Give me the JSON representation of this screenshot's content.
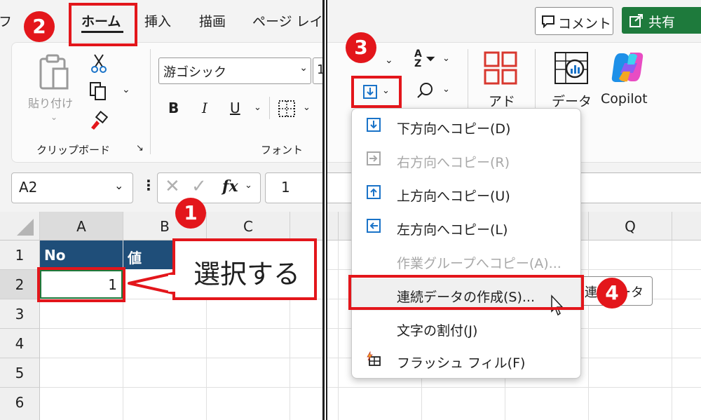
{
  "left_panel": {
    "tabs": {
      "file_partial": "フ",
      "home": "ホーム",
      "insert": "挿入",
      "draw": "描画",
      "page_partial": "ページ レイ"
    },
    "clipboard": {
      "paste_label": "貼り付け",
      "group_label": "クリップボード"
    },
    "font": {
      "font_name": "游ゴシック",
      "size_partial": "1",
      "bold": "B",
      "italic": "I",
      "underline": "U",
      "group_label": "フォント"
    },
    "formula_bar": {
      "name_box": "A2",
      "fx": "fx",
      "value": "1"
    },
    "columns": [
      "A",
      "B",
      "C"
    ],
    "rows": [
      "1",
      "2",
      "3",
      "4",
      "5",
      "6"
    ],
    "cells": {
      "a1": "No",
      "b1": "値",
      "a2": "1"
    },
    "callout": "選択する"
  },
  "right_panel": {
    "header": {
      "comment_button": "コメント",
      "share_button": "共有"
    },
    "ribbon": {
      "sort_icon_text": "AZ",
      "addin_partial": "アド",
      "data_analysis_partial": "データ",
      "copilot_label": "Copilot"
    },
    "column_q": "Q",
    "menu_items": [
      {
        "label": "下方向へコピー(D)",
        "enabled": true
      },
      {
        "label": "右方向へコピー(R)",
        "enabled": false
      },
      {
        "label": "上方向へコピー(U)",
        "enabled": true
      },
      {
        "label": "左方向へコピー(L)",
        "enabled": true
      },
      {
        "label": "作業グループへコピー(A)...",
        "enabled": false
      },
      {
        "label": "連続データの作成(S)...",
        "enabled": true
      },
      {
        "label": "文字の割付(J)",
        "enabled": true
      },
      {
        "label": "フラッシュ フィル(F)",
        "enabled": true
      }
    ],
    "tooltip_partial_left": "連",
    "tooltip_partial_right": "ータ"
  },
  "badges": [
    "1",
    "2",
    "3",
    "4"
  ],
  "colors": {
    "accent_red": "#e3161b",
    "excel_green": "#1e7a3c",
    "header_fill": "#1f4e79",
    "fill_blue": "#1a73c8"
  }
}
